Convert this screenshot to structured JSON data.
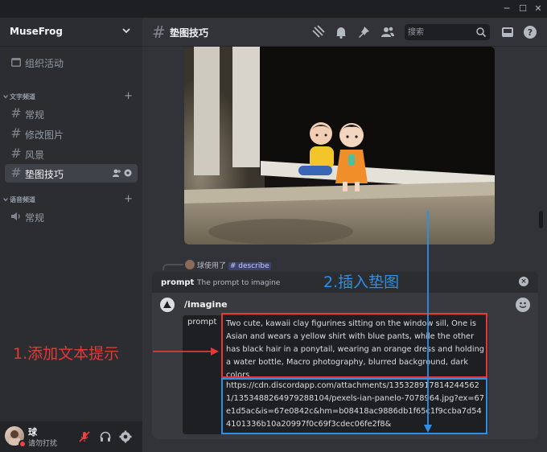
{
  "window": {
    "minimize": "─",
    "maximize": "☐",
    "close": "✕"
  },
  "server": {
    "name": "MuseFrog"
  },
  "sidebar": {
    "events_label": "组织活动",
    "text_category": "文字频道",
    "text_channels": [
      {
        "label": "常规",
        "active": false
      },
      {
        "label": "修改图片",
        "active": false
      },
      {
        "label": "风景",
        "active": false
      },
      {
        "label": "垫图技巧",
        "active": true
      }
    ],
    "voice_category": "语音频道",
    "voice_channels": [
      {
        "label": "常规"
      }
    ]
  },
  "user": {
    "name": "球",
    "status": "请勿打扰"
  },
  "header": {
    "channel_name": "垫图技巧",
    "search_placeholder": "搜索",
    "icons": [
      "threads-icon",
      "bell-icon",
      "pin-icon",
      "members-icon",
      "inbox-icon",
      "help-icon"
    ]
  },
  "reply": {
    "prefix": "球使用了",
    "command": "# describe"
  },
  "popup": {
    "option": "prompt",
    "description": "The prompt to imagine"
  },
  "composer": {
    "command": "/imagine",
    "prompt_label": "prompt",
    "prompt_text": "Two cute, kawaii clay figurines sitting on the window sill, One is Asian and wears a yellow shirt with blue pants, while the other has black hair in a ponytail, wearing an orange dress and holding a water bottle, Macro photography, blurred background, dark colors",
    "url_text": "https://cdn.discordapp.com/attachments/1353289178142445621/1353488264979288104/pexels-ian-panelo-7078964.jpg?ex=67e1d5ac&is=67e0842c&hm=b08418ac9886db1f65c1f9ccba7d544101336b10a20997f0c69f3cdec06fe2f8&"
  },
  "annotations": {
    "step1": "1.添加文本提示",
    "step2": "2.插入垫图",
    "step1_color": "#e53935",
    "step2_color": "#2f8fe5"
  },
  "colors": {
    "accent": "#5865f2",
    "dnd": "#f23f43"
  }
}
